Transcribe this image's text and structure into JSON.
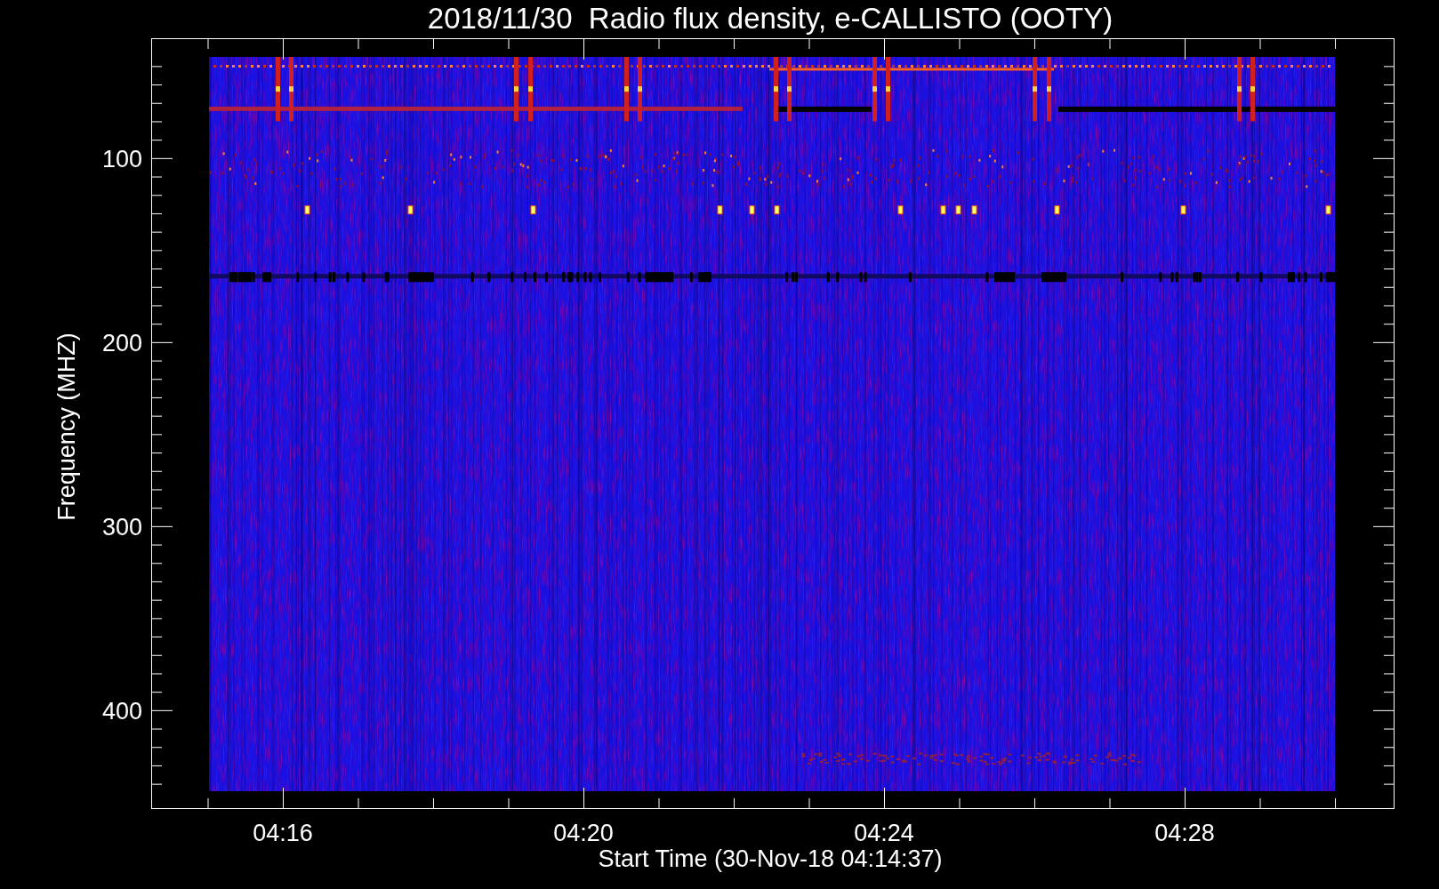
{
  "title": "2018/11/30  Radio flux density, e-CALLISTO (OOTY)",
  "y_axis": {
    "label": "Frequency (MHZ)",
    "ticks": [
      "100",
      "200",
      "300",
      "400"
    ]
  },
  "x_axis": {
    "label": "Start Time (30-Nov-18 04:14:37)",
    "ticks": [
      "04:16",
      "04:20",
      "04:24",
      "04:28"
    ]
  }
}
